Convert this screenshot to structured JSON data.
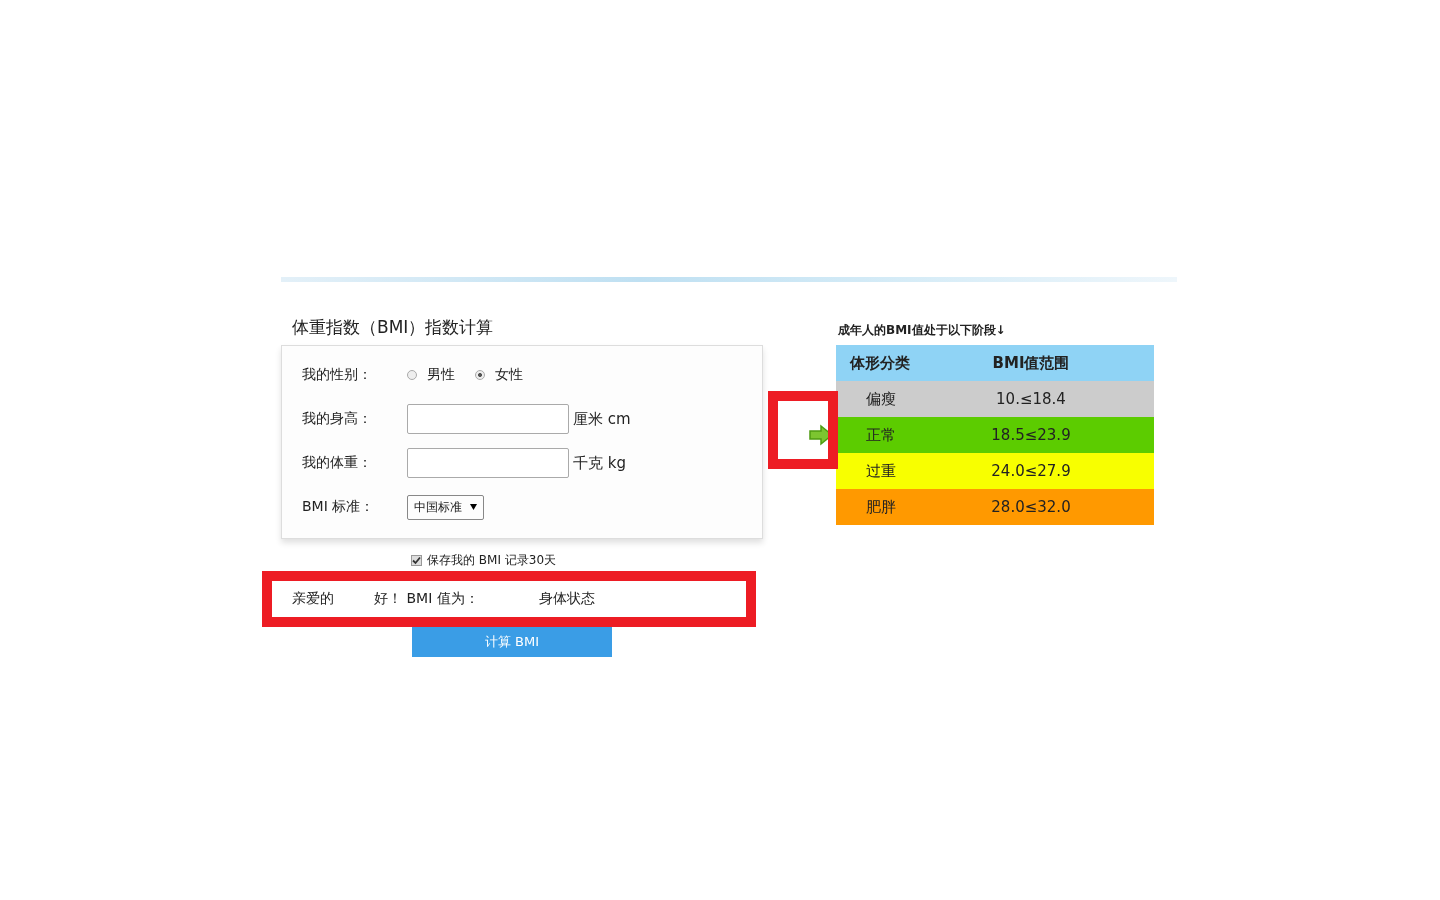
{
  "form": {
    "title": "体重指数（BMI）指数计算",
    "gender": {
      "label": "我的性别：",
      "options": [
        {
          "label": "男性",
          "selected": false
        },
        {
          "label": "女性",
          "selected": true
        }
      ]
    },
    "height": {
      "label": "我的身高：",
      "unit": "厘米 cm"
    },
    "weight": {
      "label": "我的体重：",
      "unit": "千克 kg"
    },
    "standard": {
      "label": "BMI 标准：",
      "value": "中国标准"
    }
  },
  "save_record": {
    "label": "保存我的 BMI 记录30天",
    "checked": true
  },
  "result": {
    "greeting": "亲爱的",
    "message": "好！ BMI 值为：",
    "status": "身体状态"
  },
  "calculate_button": "计算 BMI",
  "table": {
    "caption": "成年人的BMI值处于以下阶段↓",
    "columns": [
      "体形分类",
      "BMI值范围"
    ],
    "rows": [
      {
        "category": "偏瘦",
        "range": "10.≤18.4",
        "color": "#cccccc",
        "current": false
      },
      {
        "category": "正常",
        "range": "18.5≤23.9",
        "color": "#5ccc00",
        "current": true
      },
      {
        "category": "过重",
        "range": "24.0≤27.9",
        "color": "#f8ff00",
        "current": false
      },
      {
        "category": "肥胖",
        "range": "28.0≤32.0",
        "color": "#ff9900",
        "current": false
      }
    ]
  }
}
